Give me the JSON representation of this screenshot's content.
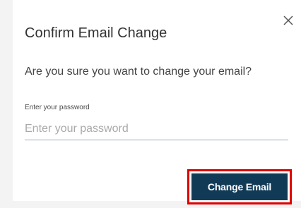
{
  "dialog": {
    "title": "Confirm Email Change",
    "message": "Are you sure you want to change your email?",
    "close_icon": "close-icon",
    "password_label": "Enter your password",
    "password_placeholder": "Enter your password",
    "password_value": "",
    "submit_label": "Change Email"
  },
  "colors": {
    "button_bg": "#113a57",
    "highlight_outline": "#e00000",
    "background": "#f3f3f3"
  }
}
